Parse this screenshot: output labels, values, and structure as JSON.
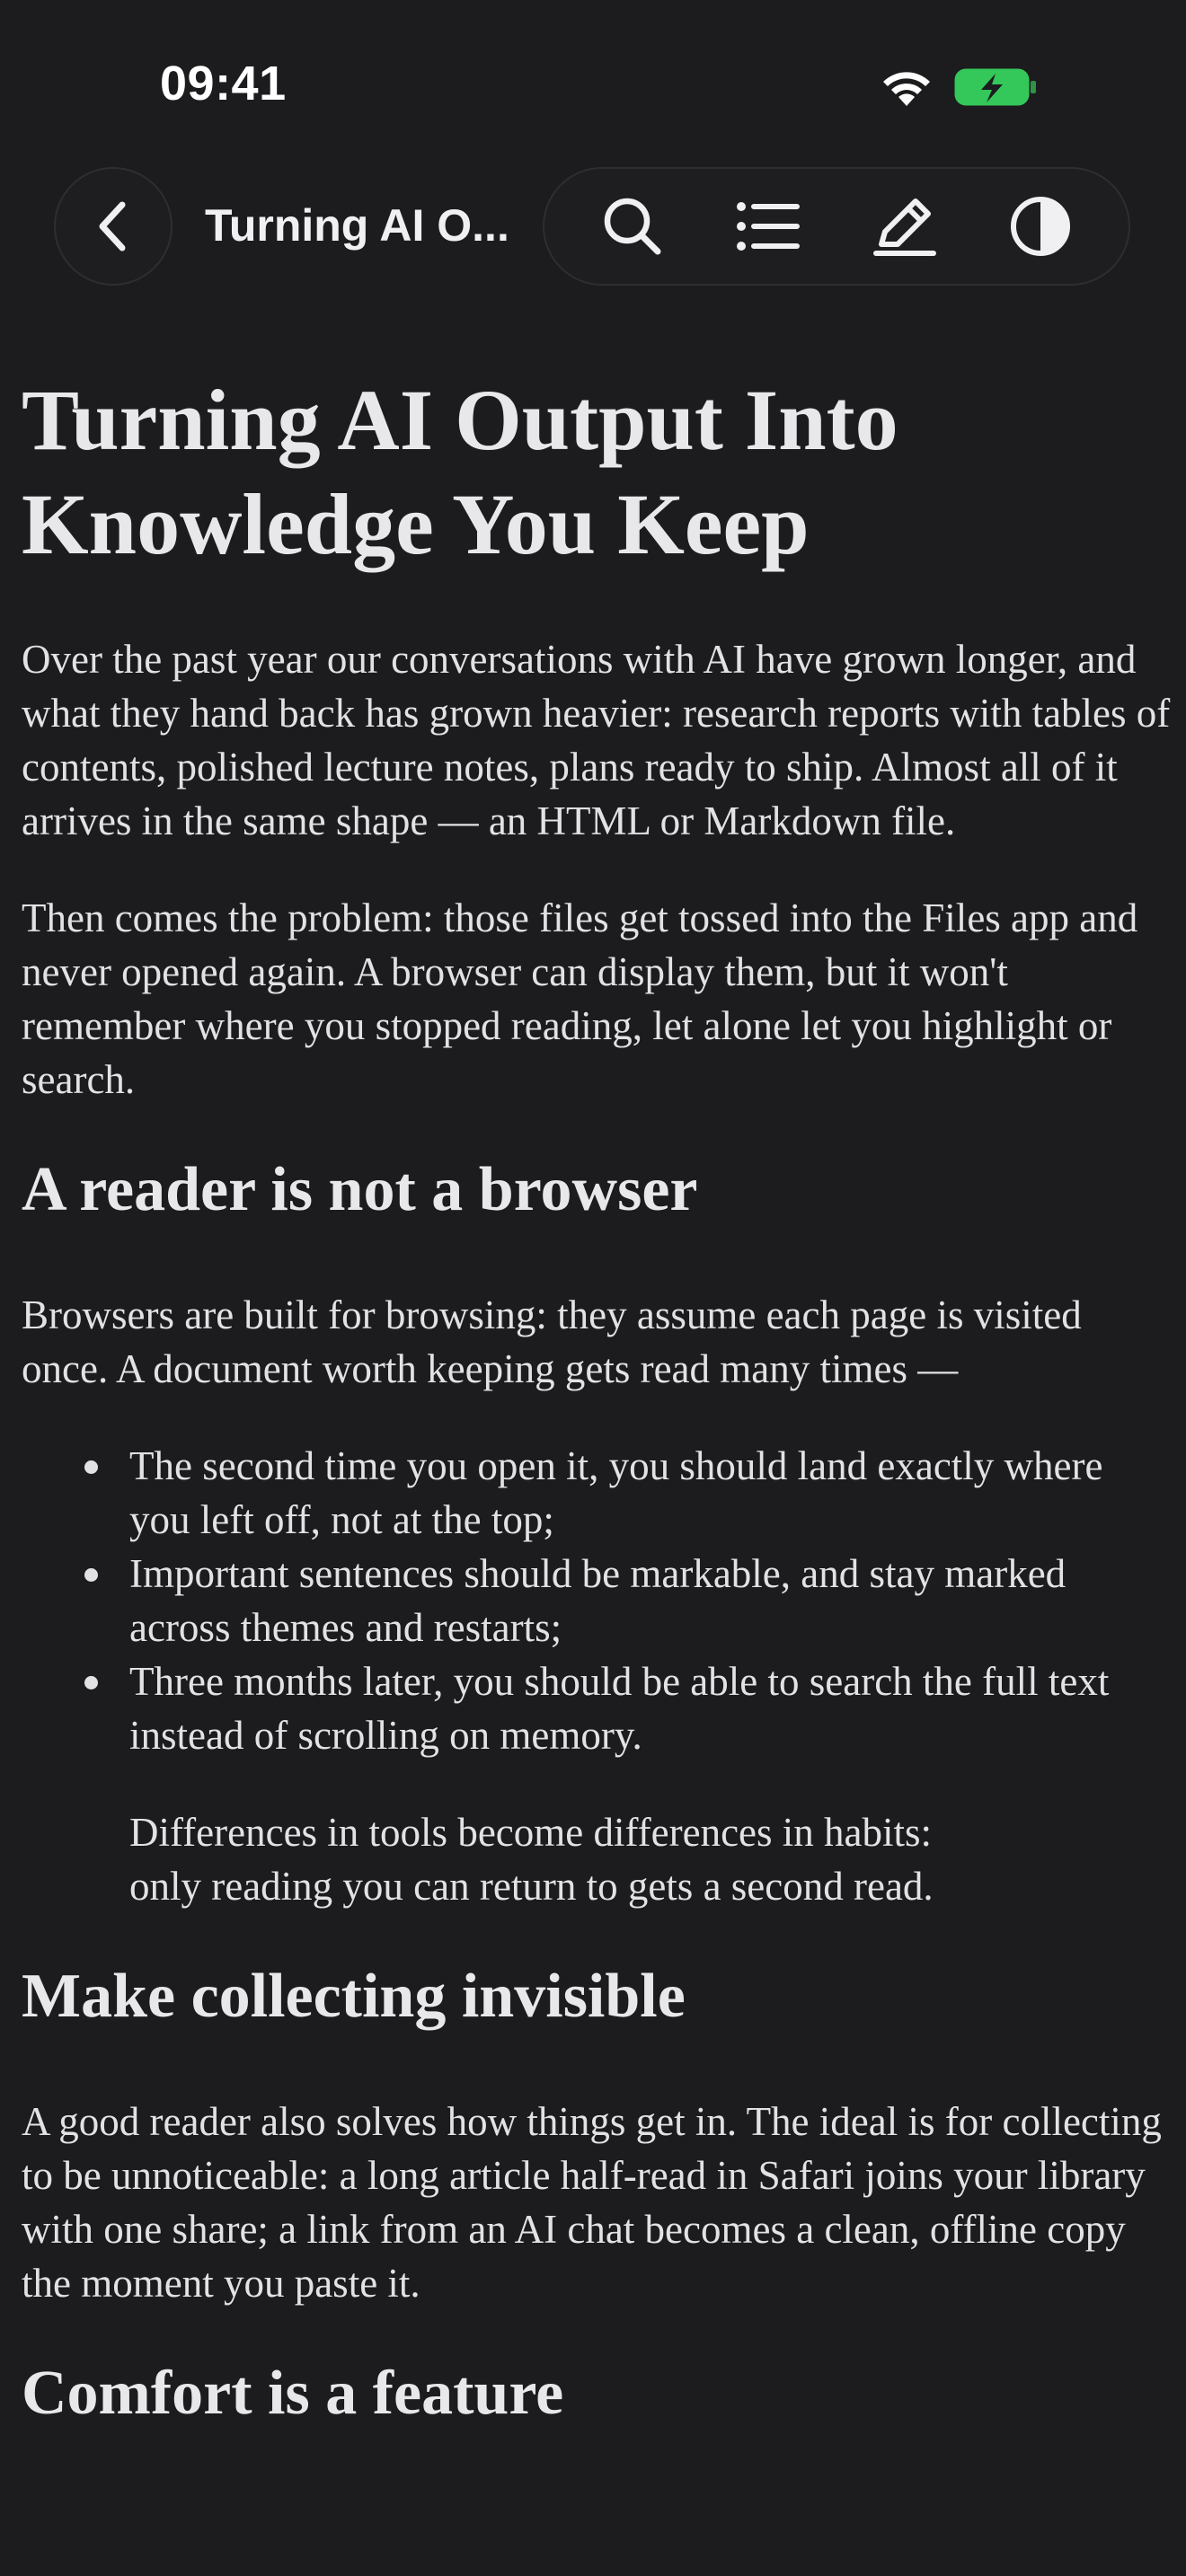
{
  "status_bar": {
    "time": "09:41"
  },
  "toolbar": {
    "title": "Turning AI O...",
    "icons": [
      "back-icon",
      "search-icon",
      "list-icon",
      "pencil-icon",
      "contrast-icon"
    ]
  },
  "article": {
    "title": "Turning AI Output Into Knowledge You Keep",
    "p1": "Over the past year our conversations with AI have grown longer, and what they hand back has grown heavier: research reports with tables of contents, polished lecture notes, plans ready to ship. Almost all of it arrives in the same shape — an HTML or Markdown file.",
    "p2": "Then comes the problem: those files get tossed into the Files app and never opened again. A browser can display them, but it won't remember where you stopped reading, let alone let you highlight or search.",
    "h2_1": "A reader is not a browser",
    "p3": "Browsers are built for browsing: they assume each page is visited once. A document worth keeping gets read many times —",
    "bullets": [
      "The second time you open it, you should land exactly where you left off, not at the top;",
      "Important sentences should be markable, and stay marked across themes and restarts;",
      "Three months later, you should be able to search the full text instead of scrolling on memory."
    ],
    "quote_line1": "Differences in tools become differences in habits:",
    "quote_line2": "only reading you can return to gets a second read.",
    "h2_2": "Make collecting invisible",
    "p4": "A good reader also solves how things get in. The ideal is for collecting to be unnoticeable: a long article half-read in Safari joins your library with one share; a link from an AI chat becomes a clean, offline copy the moment you paste it.",
    "h2_3": "Comfort is a feature"
  },
  "colors": {
    "background": "#1c1c1e",
    "text": "#e2e2e4",
    "battery_fill": "#34c759"
  }
}
